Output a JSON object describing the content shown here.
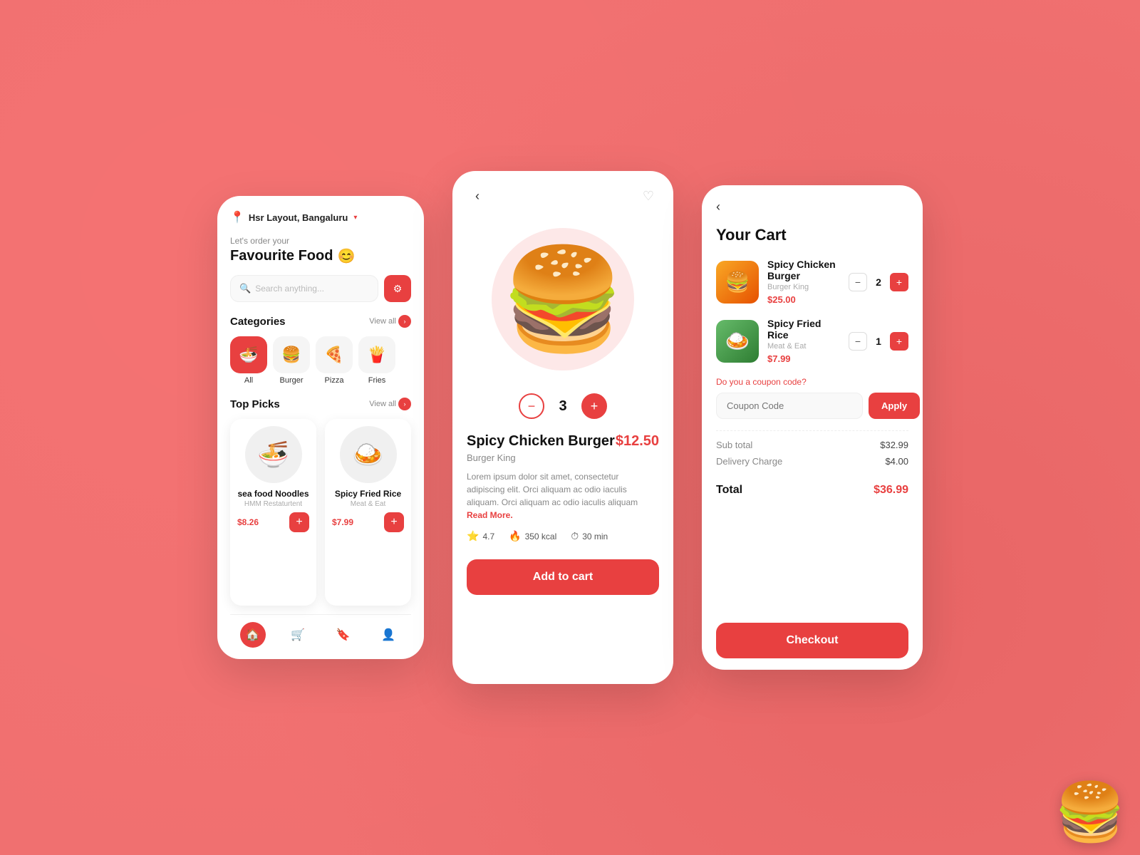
{
  "background": {
    "color": "#f07070"
  },
  "screen1": {
    "location": "Hsr Layout, Bangaluru",
    "greeting_sub": "Let's order your",
    "greeting_main": "Favourite Food",
    "greeting_emoji": "😊",
    "search_placeholder": "Search anything...",
    "filter_icon": "≡",
    "categories_title": "Categories",
    "view_all_label": "View all",
    "categories": [
      {
        "label": "All",
        "icon": "🍜",
        "active": true
      },
      {
        "label": "Burger",
        "icon": "🍔",
        "active": false
      },
      {
        "label": "Pizza",
        "icon": "🍕",
        "active": false
      },
      {
        "label": "Fries",
        "icon": "🍟",
        "active": false
      }
    ],
    "top_picks_title": "Top Picks",
    "foods": [
      {
        "name": "sea food Noodles",
        "restaurant": "HMM Restaturtent",
        "price": "$8.26",
        "emoji": "🍜"
      },
      {
        "name": "Spicy Fried Rice",
        "restaurant": "Meat & Eat",
        "price": "$7.99",
        "emoji": "🍛"
      }
    ],
    "nav_items": [
      "🏠",
      "🛒",
      "🔖",
      "👤"
    ]
  },
  "screen2": {
    "food_name": "Spicy Chicken Burger",
    "restaurant": "Burger King",
    "price": "$12.50",
    "quantity": "3",
    "description": "Lorem ipsum dolor sit amet, consectetur adipiscing elit. Orci aliquam ac odio iaculis aliquam. Orci aliquam ac odio iaculis aliquam",
    "read_more": "Read More.",
    "rating": "4.7",
    "calories": "350 kcal",
    "time": "30 min",
    "add_to_cart": "Add to cart"
  },
  "screen3": {
    "title": "Your Cart",
    "items": [
      {
        "name": "Spicy Chicken Burger",
        "restaurant": "Burger King",
        "price": "$25.00",
        "quantity": "2",
        "emoji": "🍔"
      },
      {
        "name": "Spicy Fried Rice",
        "restaurant": "Meat & Eat",
        "price": "$7.99",
        "quantity": "1",
        "emoji": "🍛"
      }
    ],
    "coupon_question": "Do you a coupon code?",
    "coupon_placeholder": "Coupon Code",
    "apply_label": "Apply",
    "subtotal_label": "Sub total",
    "subtotal_value": "$32.99",
    "delivery_label": "Delivery Charge",
    "delivery_value": "$4.00",
    "total_label": "Total",
    "total_value": "$36.99",
    "checkout_label": "Checkout"
  }
}
